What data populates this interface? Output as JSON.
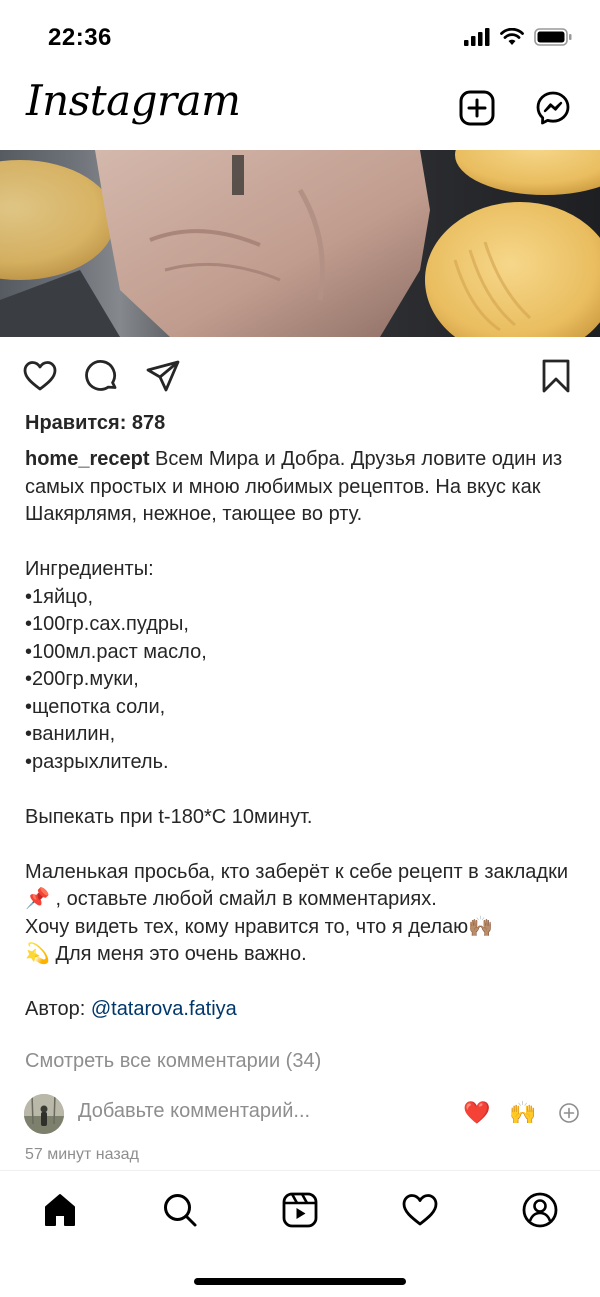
{
  "status_bar": {
    "time": "22:36"
  },
  "header": {
    "logo": "Instagram",
    "new_post_icon": "plus-square-icon",
    "messenger_icon": "messenger-icon"
  },
  "post": {
    "likes": "Нравится: 878",
    "author": "home_recept",
    "caption_intro": " Всем Мира и Добра. Друзья ловите один из самых простых и мною любимых рецептов. На вкус как Шакярлямя, нежное, тающее во рту.",
    "ingredients_title": "Ингредиенты:",
    "ingredients": [
      "•1яйцо,",
      "•100гр.сах.пудры,",
      "•100мл.раст масло,",
      "•200гр.муки,",
      "•щепотка соли,",
      "•ванилин,",
      "•разрыхлитель."
    ],
    "bake": "Выпекать при t-180*С 10минут.",
    "request_1": "Маленькая просьба, кто заберёт к себе рецепт в закладки📌 , оставьте любой смайл в комментариях.",
    "request_2": "Хочу видеть тех, кому нравится то, что я делаю🙌🏽",
    "request_3": "💫 Для меня это очень важно.",
    "author_label": "Автор: ",
    "author_mention": "@tatarova.fatiya",
    "view_comments": "Смотреть все комментарии (34)",
    "comment_placeholder": "Добавьте комментарий...",
    "quick_emoji_1": "❤️",
    "quick_emoji_2": "🙌",
    "timestamp": "57 минут назад"
  },
  "actions": {
    "like_icon": "heart-icon",
    "comment_icon": "comment-icon",
    "share_icon": "share-icon",
    "save_icon": "bookmark-icon"
  },
  "bottom_nav": [
    "home-icon",
    "search-icon",
    "reels-icon",
    "activity-heart-icon",
    "profile-icon"
  ],
  "colors": {
    "text": "#262626",
    "muted": "#8e8e8e",
    "link": "#00376b",
    "background": "#ffffff"
  }
}
